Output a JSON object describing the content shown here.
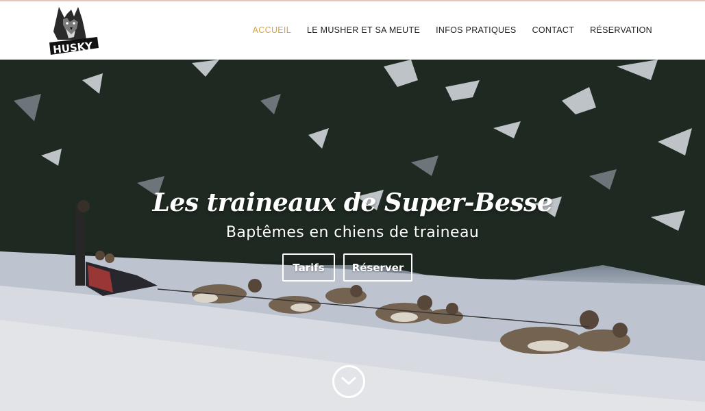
{
  "header": {
    "logo_text": "HUSKY",
    "nav": [
      {
        "label": "ACCUEIL",
        "active": true
      },
      {
        "label": "LE MUSHER ET SA MEUTE",
        "active": false
      },
      {
        "label": "INFOS PRATIQUES",
        "active": false
      },
      {
        "label": "CONTACT",
        "active": false
      },
      {
        "label": "RÉSERVATION",
        "active": false
      }
    ]
  },
  "hero": {
    "title": "Les traineaux de Super-Besse",
    "subtitle": "Baptêmes en chiens de traineau",
    "buttons": {
      "tarifs": "Tarifs",
      "reserver": "Réserver"
    },
    "scroll_icon": "chevron-down-icon"
  },
  "colors": {
    "accent": "#d8a33a",
    "nav_text": "#1f1f1f",
    "hero_text": "#ffffff"
  }
}
